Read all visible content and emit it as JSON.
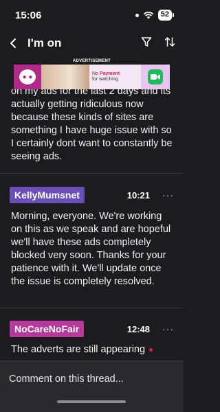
{
  "status": {
    "time": "15:06",
    "battery": "52"
  },
  "nav": {
    "title": "I'm on",
    "icons": [
      "back-icon",
      "filter-icon",
      "sort-icon"
    ]
  },
  "ad": {
    "label": "ADVERTISEMENT",
    "line1_prefix": "No ",
    "line1_highlight": "Payment",
    "line2": "for watching"
  },
  "posts": [
    {
      "text": "on my ads for the last 2 days and its actually getting ridiculous now because these kinds of sites are something I have huge issue with so I certainly dont want to constantly be seeing ads."
    },
    {
      "author": "KellyMumsnet",
      "time": "10:21",
      "badge_color": "#6b4fb8",
      "text": "Morning, everyone. We're working on this as we speak and are hopeful we'll have these ads completely blocked very soon. Thanks for your patience with it. We'll update once the issue is completely resolved."
    },
    {
      "author": "NoCareNoFair",
      "time": "12:48",
      "badge_color": "#b43a9c",
      "text": "The adverts are still appearing"
    }
  ],
  "comment": {
    "placeholder": "Comment on this thread..."
  }
}
